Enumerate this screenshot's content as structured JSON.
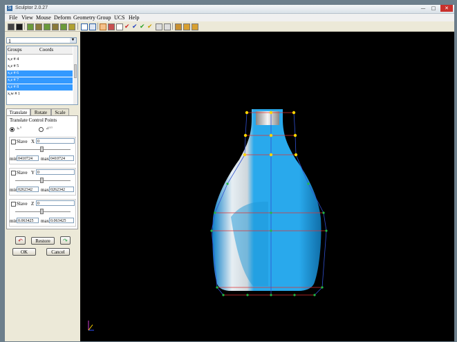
{
  "window": {
    "title": "Sculptor 2.0.27",
    "app_icon": "S"
  },
  "window_controls": {
    "minimize": "—",
    "maximize": "□",
    "close": "✕"
  },
  "menu": [
    "File",
    "View",
    "Mouse",
    "Deform",
    "Geometry",
    "Group",
    "UCS",
    "Help"
  ],
  "selector": {
    "value": "1"
  },
  "groups": {
    "headers": [
      "Groups",
      "Coords"
    ],
    "rows": [
      {
        "label": "x,z # 4",
        "selected": false
      },
      {
        "label": "x,z # 5",
        "selected": false
      },
      {
        "label": "x,z # 6",
        "selected": true
      },
      {
        "label": "x,z # 7",
        "selected": true
      },
      {
        "label": "x,z # 8",
        "selected": true
      },
      {
        "label": "x,w # 1",
        "selected": false
      }
    ]
  },
  "tabs": [
    "Translate",
    "Rotate",
    "Scale"
  ],
  "active_tab": "Translate",
  "panel": {
    "heading": "Translate Control Points",
    "mode_options": [
      "xyz (local)",
      "xyz (global)"
    ]
  },
  "axes": [
    {
      "slave_label": "Slave",
      "axis": "X",
      "value": "0",
      "min_label": "min",
      "min": "0410724",
      "max_label": "max",
      "max": "0410724"
    },
    {
      "slave_label": "Slave",
      "axis": "Y",
      "value": "0",
      "min_label": "min",
      "min": "0262342",
      "max_label": "max",
      "max": "0262342"
    },
    {
      "slave_label": "Slave",
      "axis": "Z",
      "value": "0",
      "min_label": "min",
      "min": "0.063425",
      "max_label": "max",
      "max": "0.063425"
    }
  ],
  "buttons": {
    "restore": "Restore",
    "ok": "OK",
    "cancel": "Cancel"
  },
  "colors": {
    "bottle": "#29a9ec",
    "bottle_highlight": "#e8eef2",
    "cage_lines": "#e03030",
    "control_points_selected": "#ffd400",
    "control_points": "#22bb44",
    "viewport_bg": "#000000"
  }
}
